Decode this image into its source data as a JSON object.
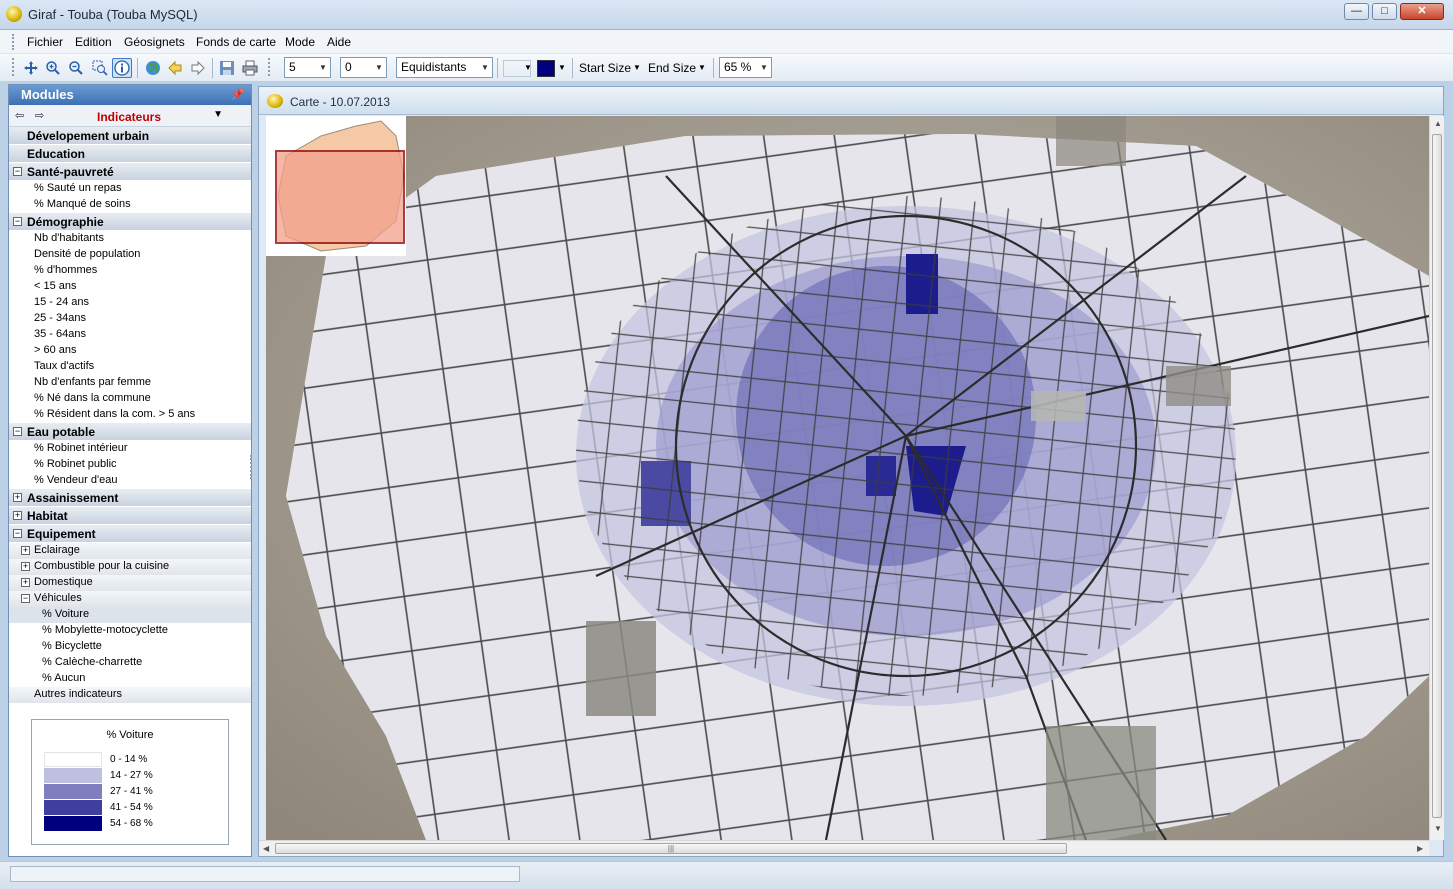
{
  "window": {
    "title": "Giraf - Touba  (Touba MySQL)",
    "buttons": [
      "—",
      "□",
      "✕"
    ]
  },
  "menu": [
    "Fichier",
    "Edition",
    "Géosignets",
    "Fonds de carte",
    "Mode",
    "Aide"
  ],
  "toolbar": {
    "tools": [
      "pan-icon",
      "zoom-in-icon",
      "zoom-out-icon",
      "zoom-rect-icon",
      "info-icon",
      "globe-icon",
      "back-icon",
      "forward-icon",
      "save-icon",
      "print-icon"
    ],
    "classes_value": "5",
    "decimals_value": "0",
    "method_value": "Equidistants",
    "color_start": "#ffffff",
    "color_end": "#00007f",
    "start_size_label": "Start Size",
    "end_size_label": "End Size",
    "opacity_value": "65 %"
  },
  "panel": {
    "title": "Modules",
    "indicator_label": "Indicateurs",
    "groups": [
      {
        "label": "Dévelopement urbain",
        "toggle": ""
      },
      {
        "label": "Education",
        "toggle": ""
      },
      {
        "label": "Santé-pauvreté",
        "toggle": "−",
        "items": [
          "% Sauté un repas",
          "% Manqué de soins"
        ]
      },
      {
        "label": "Démographie",
        "toggle": "−",
        "items": [
          "Nb d'habitants",
          "Densité de population",
          "% d'hommes",
          "< 15 ans",
          "15 - 24 ans",
          "25 - 34ans",
          "35 - 64ans",
          "> 60 ans",
          "Taux d'actifs",
          "Nb d'enfants par femme",
          "% Né dans la commune",
          "% Résident dans la com. > 5 ans"
        ]
      },
      {
        "label": "Eau potable",
        "toggle": "−",
        "items": [
          "% Robinet intérieur",
          "% Robinet public",
          "% Vendeur d'eau"
        ]
      },
      {
        "label": "Assainissement",
        "toggle": "+"
      },
      {
        "label": "Habitat",
        "toggle": "+"
      },
      {
        "label": "Equipement",
        "toggle": "−"
      }
    ],
    "equipement_subs": [
      {
        "label": "Eclairage",
        "toggle": "+"
      },
      {
        "label": "Combustible pour la cuisine",
        "toggle": "+"
      },
      {
        "label": "Domestique",
        "toggle": "+"
      },
      {
        "label": "Véhicules",
        "toggle": "−"
      }
    ],
    "vehicules_items": [
      "% Voiture",
      "% Mobylette-motocyclette",
      "% Bicyclette",
      "% Calèche-charrette",
      "% Aucun"
    ],
    "selected_item": "% Voiture",
    "autres": "Autres indicateurs"
  },
  "legend": {
    "title": "% Voiture",
    "classes": [
      {
        "label": "0 -  14  %",
        "color": "#ffffff"
      },
      {
        "label": "14 -  27  %",
        "color": "#bfbfdf"
      },
      {
        "label": "27 -  41  %",
        "color": "#7f7fbf"
      },
      {
        "label": "41 -  54  %",
        "color": "#3f3f9f"
      },
      {
        "label": "54 -  68  %",
        "color": "#00007f"
      }
    ]
  },
  "map": {
    "title": "Carte - 10.07.2013"
  }
}
